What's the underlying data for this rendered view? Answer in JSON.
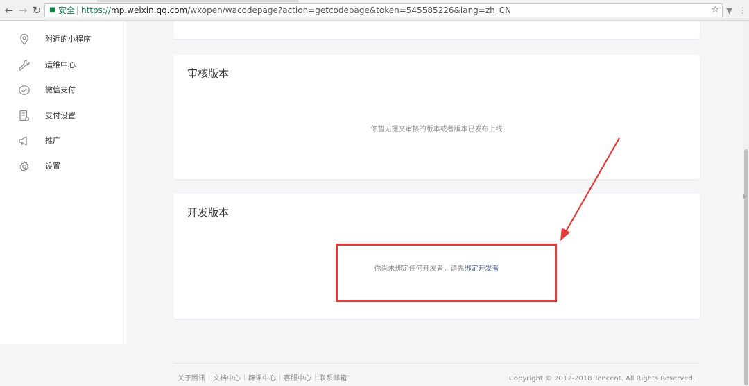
{
  "browser": {
    "secure_label": "安全",
    "url_scheme": "https://",
    "url_host": "mp.weixin.qq.com",
    "url_path": "/wxopen/wacodepage?action=getcodepage&token=545585226&lang=zh_CN"
  },
  "sidebar": {
    "items": [
      {
        "label": "附近的小程序",
        "icon": "location-pin-icon"
      },
      {
        "label": "运维中心",
        "icon": "wrench-icon"
      },
      {
        "label": "微信支付",
        "icon": "wechat-pay-icon"
      },
      {
        "label": "支付设置",
        "icon": "payment-settings-icon"
      },
      {
        "label": "推广",
        "icon": "megaphone-icon"
      },
      {
        "label": "设置",
        "icon": "gear-icon"
      }
    ]
  },
  "review_version": {
    "title": "审核版本",
    "empty_text": "你暂无提交审核的版本或者版本已发布上线"
  },
  "dev_version": {
    "title": "开发版本",
    "empty_text": "你尚未绑定任何开发者，请先",
    "link_text": "绑定开发者"
  },
  "footer": {
    "links": [
      "关于腾讯",
      "文档中心",
      "辟谣中心",
      "客服中心",
      "联系邮箱"
    ],
    "copyright": "Copyright © 2012-2018 Tencent. All Rights Reserved."
  },
  "annotation_color": "#e03b3b",
  "link_color": "#576b95"
}
